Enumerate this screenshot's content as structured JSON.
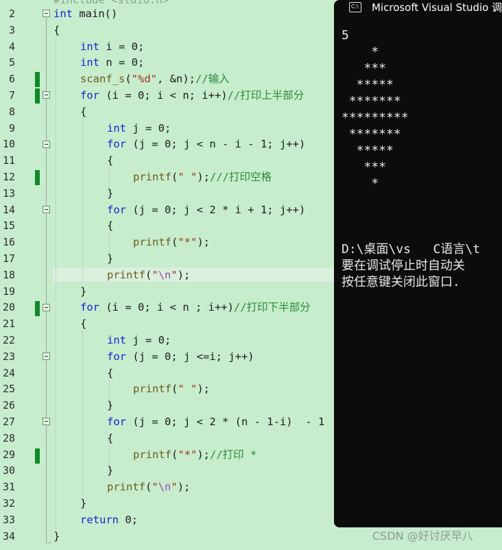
{
  "editor": {
    "top_partial_line": "#include <stdio.h>",
    "current_line": "18",
    "lines": [
      {
        "n": "2",
        "code": ""
      },
      {
        "n": "3",
        "code": ""
      },
      {
        "n": "4",
        "code": ""
      },
      {
        "n": "5",
        "code": ""
      },
      {
        "n": "6",
        "code": ""
      },
      {
        "n": "7",
        "code": ""
      },
      {
        "n": "8",
        "code": ""
      },
      {
        "n": "9",
        "code": ""
      },
      {
        "n": "10",
        "code": ""
      },
      {
        "n": "11",
        "code": ""
      },
      {
        "n": "12",
        "code": ""
      },
      {
        "n": "13",
        "code": ""
      },
      {
        "n": "14",
        "code": ""
      },
      {
        "n": "15",
        "code": ""
      },
      {
        "n": "16",
        "code": ""
      },
      {
        "n": "17",
        "code": ""
      },
      {
        "n": "18",
        "code": ""
      },
      {
        "n": "19",
        "code": ""
      },
      {
        "n": "20",
        "code": ""
      },
      {
        "n": "21",
        "code": ""
      },
      {
        "n": "22",
        "code": ""
      },
      {
        "n": "23",
        "code": ""
      },
      {
        "n": "24",
        "code": ""
      },
      {
        "n": "25",
        "code": ""
      },
      {
        "n": "26",
        "code": ""
      },
      {
        "n": "27",
        "code": ""
      },
      {
        "n": "28",
        "code": ""
      },
      {
        "n": "29",
        "code": ""
      },
      {
        "n": "30",
        "code": ""
      },
      {
        "n": "31",
        "code": ""
      },
      {
        "n": "32",
        "code": ""
      },
      {
        "n": "33",
        "code": ""
      },
      {
        "n": "34",
        "code": ""
      }
    ],
    "tokens": {
      "l2": [
        "int",
        " main()"
      ],
      "l3": [
        "{"
      ],
      "l4": [
        "int",
        " i = 0;"
      ],
      "l5": [
        "int",
        " n = 0;"
      ],
      "l6": [
        "scanf_s",
        "(",
        "\"%d\"",
        ", &n);",
        "//输入"
      ],
      "l7": [
        "for",
        " (i = 0; i < n; i++)",
        "//打印上半部分"
      ],
      "l8": [
        "{"
      ],
      "l9": [
        "int",
        " j = 0;"
      ],
      "l10": [
        "for",
        " (j = 0; j < n - i - 1; j++)"
      ],
      "l11": [
        "{"
      ],
      "l12": [
        "printf",
        "(",
        "\" \"",
        ");",
        "///打印空格"
      ],
      "l13": [
        "}"
      ],
      "l14": [
        "for",
        " (j = 0; j < 2 * i + 1; j++)"
      ],
      "l15": [
        "{"
      ],
      "l16": [
        "printf",
        "(",
        "\"*\"",
        ");"
      ],
      "l17": [
        "}"
      ],
      "l18": [
        "printf",
        "(",
        "\"",
        "\\n",
        "\"",
        ");"
      ],
      "l19": [
        "}"
      ],
      "l20": [
        "for",
        " (i = 0; i < n ; i++)",
        "//打印下半部分"
      ],
      "l21": [
        "{"
      ],
      "l22": [
        "int",
        " j = 0;"
      ],
      "l23": [
        "for",
        " (j = 0; j <=i; j++)"
      ],
      "l24": [
        "{"
      ],
      "l25": [
        "printf",
        "(",
        "\" \"",
        ");"
      ],
      "l26": [
        "}"
      ],
      "l27": [
        "for",
        " (j = 0; j < 2 * (n - 1-i)  - 1"
      ],
      "l28": [
        "{"
      ],
      "l29": [
        "printf",
        "(",
        "\"*\"",
        ");",
        "//打印 *"
      ],
      "l30": [
        "}"
      ],
      "l31": [
        "printf",
        "(",
        "\"",
        "\\n",
        "\"",
        ");"
      ],
      "l32": [
        "}"
      ],
      "l33": [
        "return",
        " 0;"
      ],
      "l34": [
        "}"
      ]
    }
  },
  "console": {
    "title": "Microsoft Visual Studio 调试",
    "icon": "console-window-icon",
    "icon_text": "C:\\",
    "output_lines": [
      "5",
      "    *",
      "   ***",
      "  *****",
      " *******",
      "*********",
      " *******",
      "  *****",
      "   ***",
      "    *",
      "",
      "",
      "",
      "D:\\桌面\\vs   C语言\\t",
      "要在调试停止时自动关",
      "按任意键关闭此窗口. "
    ]
  },
  "watermark": "CSDN @好讨厌早八",
  "colors": {
    "editor_bg": "#c7edcc",
    "keyword": "#1b1bd8",
    "string": "#a3321c",
    "comment": "#2a8a3a",
    "change_marker": "#0f8a2a",
    "console_bg": "#0c0c0c"
  }
}
